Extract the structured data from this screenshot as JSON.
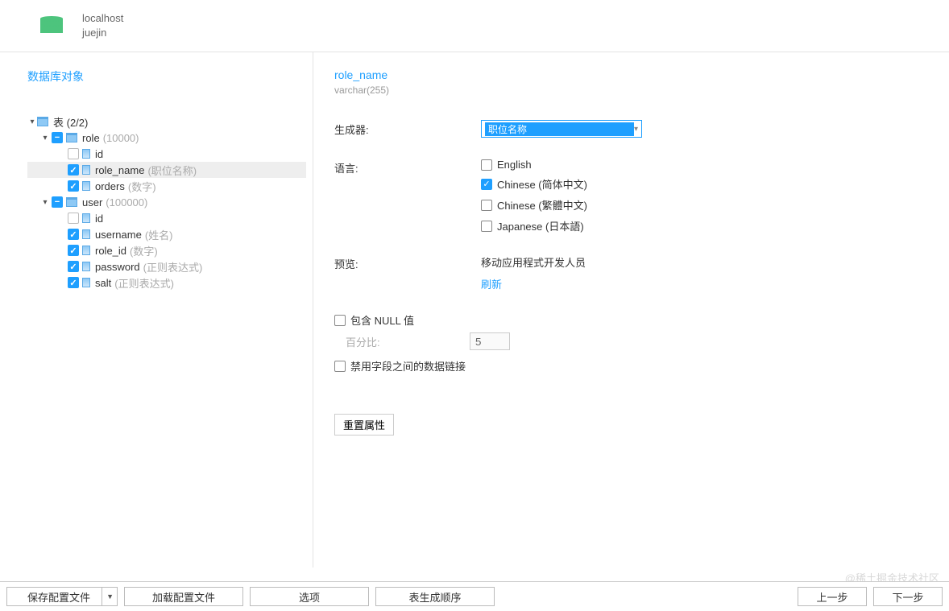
{
  "header": {
    "host": "localhost",
    "db": "juejin"
  },
  "left": {
    "title": "数据库对象",
    "tables_label": "表 (2/2)",
    "tables": [
      {
        "name": "role",
        "hint": "(10000)",
        "cols": [
          {
            "name": "id",
            "hint": "",
            "checked": false,
            "selected": false
          },
          {
            "name": "role_name",
            "hint": "(职位名称)",
            "checked": true,
            "selected": true
          },
          {
            "name": "orders",
            "hint": "(数字)",
            "checked": true,
            "selected": false
          }
        ]
      },
      {
        "name": "user",
        "hint": "(100000)",
        "cols": [
          {
            "name": "id",
            "hint": "",
            "checked": false,
            "selected": false
          },
          {
            "name": "username",
            "hint": "(姓名)",
            "checked": true,
            "selected": false
          },
          {
            "name": "role_id",
            "hint": "(数字)",
            "checked": true,
            "selected": false
          },
          {
            "name": "password",
            "hint": "(正则表达式)",
            "checked": true,
            "selected": false
          },
          {
            "name": "salt",
            "hint": "(正则表达式)",
            "checked": true,
            "selected": false
          }
        ]
      }
    ]
  },
  "right": {
    "field_name": "role_name",
    "field_type": "varchar(255)",
    "gen_label": "生成器:",
    "gen_value": "职位名称",
    "lang_label": "语言:",
    "langs": [
      {
        "label": "English",
        "checked": false
      },
      {
        "label": "Chinese (简体中文)",
        "checked": true
      },
      {
        "label": "Chinese (繁體中文)",
        "checked": false
      },
      {
        "label": "Japanese (日本語)",
        "checked": false
      }
    ],
    "preview_label": "预览:",
    "preview_value": "移动应用程式开发人员",
    "refresh": "刷新",
    "null_label": "包含 NULL 值",
    "pct_label": "百分比:",
    "pct_value": "5",
    "disable_link_label": "禁用字段之间的数据链接",
    "reset_btn": "重置属性"
  },
  "footer": {
    "save_profile": "保存配置文件",
    "load_profile": "加载配置文件",
    "options": "选项",
    "order": "表生成顺序",
    "prev": "上一步",
    "next": "下一步"
  },
  "watermark": "@稀土掘金技术社区"
}
